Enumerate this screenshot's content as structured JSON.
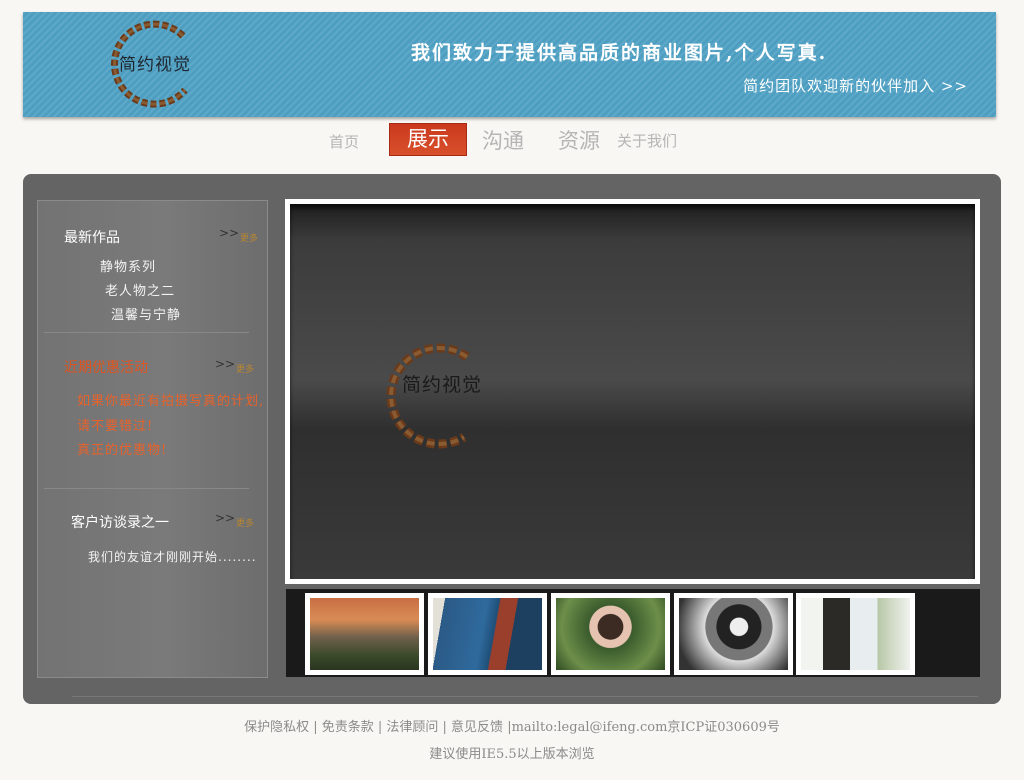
{
  "header": {
    "logo_text": "简约视觉",
    "slogan": "我们致力于提供高品质的商业图片,个人写真.",
    "join_link": "简约团队欢迎新的伙伴加入 >>"
  },
  "nav": {
    "items": [
      "首页",
      "展示",
      "沟通",
      "资源",
      "关于我们"
    ],
    "active": "展示"
  },
  "sidebar": {
    "latest": {
      "title": "最新作品",
      "arrow": ">>",
      "more": "更多",
      "items": [
        "静物系列",
        "老人物之二",
        "温馨与宁静"
      ]
    },
    "promo": {
      "title": "近期优惠活动",
      "arrow": ">>",
      "more": "更多",
      "lines": [
        "如果你最近有拍摄写真的计划,",
        "请不要错过!",
        "真正的优惠物!"
      ]
    },
    "interview": {
      "title": "客户访谈录之一",
      "arrow": ">>",
      "more": "更多",
      "text": "我们的友谊才刚刚开始........"
    }
  },
  "showcase": {
    "logo_text": "简约视觉",
    "thumbnails": [
      "landscape-photographer",
      "lake-bridge",
      "girl-garden",
      "woman-bw-portrait",
      "boy-outdoor"
    ]
  },
  "footer": {
    "links": "保护隐私权 | 免责条款 | 法律顾问 | 意见反馈 |mailto:legal@ifeng.com京ICP证030609号",
    "browser_note": "建议使用IE5.5以上版本浏览"
  },
  "colors": {
    "banner": "#4d9ec1",
    "nav_active": "#d9512c",
    "panel": "#646464",
    "promo": "#e8622a"
  }
}
